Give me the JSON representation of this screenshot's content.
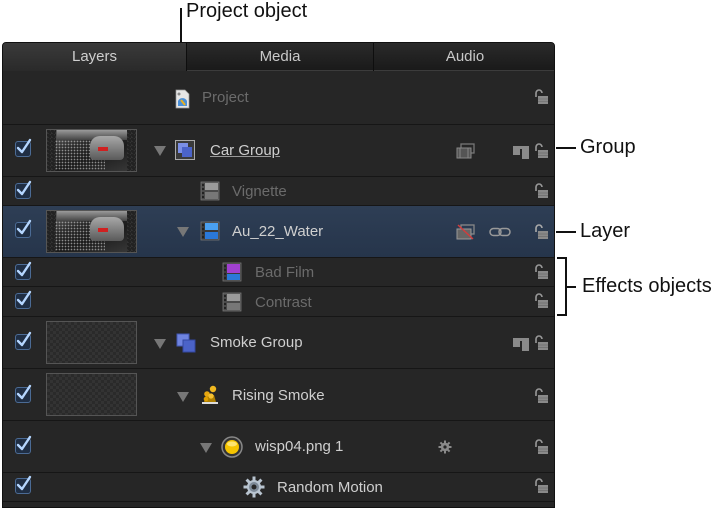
{
  "callouts": {
    "project_object": "Project object",
    "group": "Group",
    "layer": "Layer",
    "effects_objects": "Effects objects"
  },
  "tabs": [
    {
      "label": "Layers",
      "active": true
    },
    {
      "label": "Media",
      "active": false
    },
    {
      "label": "Audio",
      "active": false
    }
  ],
  "rows": [
    {
      "name": "Project",
      "type": "project",
      "checked": null,
      "dim": true
    },
    {
      "name": "Car Group",
      "type": "group",
      "checked": true,
      "thumbnail": "car",
      "expanded": true
    },
    {
      "name": "Vignette",
      "type": "filter",
      "checked": true,
      "dim": true
    },
    {
      "name": "Au_22_Water",
      "type": "layer",
      "checked": true,
      "thumbnail": "car",
      "expanded": true,
      "selected": true
    },
    {
      "name": "Bad Film",
      "type": "filter",
      "checked": true,
      "dim": true
    },
    {
      "name": "Contrast",
      "type": "filter",
      "checked": true,
      "dim": true
    },
    {
      "name": "Smoke Group",
      "type": "group",
      "checked": true,
      "thumbnail": "empty",
      "expanded": true
    },
    {
      "name": "Rising Smoke",
      "type": "emitter",
      "checked": true,
      "thumbnail": "empty",
      "expanded": true
    },
    {
      "name": "wisp04.png 1",
      "type": "cell",
      "checked": true,
      "expanded": true
    },
    {
      "name": "Random Motion",
      "type": "behavior",
      "checked": true
    }
  ],
  "colors": {
    "panel_bg": "#262626",
    "selected_row": "#2e3e55",
    "checkbox_check": "#a9d0ff",
    "text": "#cfcfcf",
    "text_dim": "#6b6b6b"
  }
}
